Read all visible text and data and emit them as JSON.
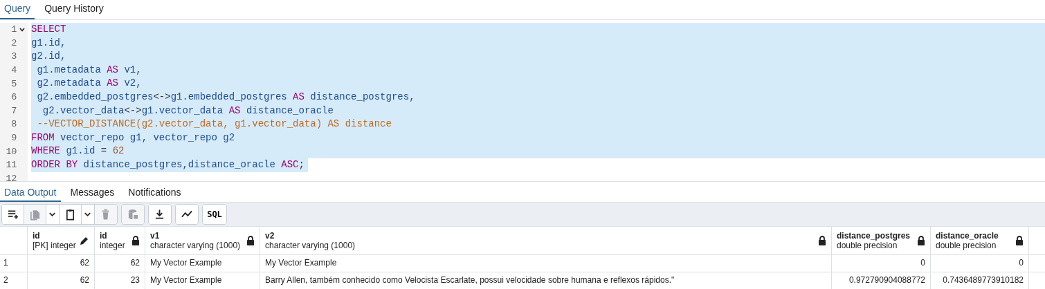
{
  "editor_tabs": [
    {
      "label": "Query",
      "selected": true
    },
    {
      "label": "Query History",
      "selected": false
    }
  ],
  "editor": {
    "lines": [
      {
        "number": "1",
        "foldable": true,
        "selected": true,
        "tokens": [
          {
            "kind": "kw",
            "text": "SELECT"
          }
        ]
      },
      {
        "number": "2",
        "foldable": false,
        "selected": true,
        "tokens": [
          {
            "kind": "id",
            "text": "g1.id,"
          }
        ]
      },
      {
        "number": "3",
        "foldable": false,
        "selected": true,
        "tokens": [
          {
            "kind": "id",
            "text": "g2.id,"
          }
        ]
      },
      {
        "number": "4",
        "foldable": false,
        "selected": true,
        "tokens": [
          {
            "kind": "id",
            "text": " g1.metadata "
          },
          {
            "kind": "kw",
            "text": "AS"
          },
          {
            "kind": "id",
            "text": " v1,"
          }
        ]
      },
      {
        "number": "5",
        "foldable": false,
        "selected": true,
        "tokens": [
          {
            "kind": "id",
            "text": " g2.metadata "
          },
          {
            "kind": "kw",
            "text": "AS"
          },
          {
            "kind": "id",
            "text": " v2,"
          }
        ]
      },
      {
        "number": "6",
        "foldable": false,
        "selected": true,
        "tokens": [
          {
            "kind": "id",
            "text": " g2.embedded_postgres"
          },
          {
            "kind": "op",
            "text": "<->"
          },
          {
            "kind": "id",
            "text": "g1.embedded_postgres "
          },
          {
            "kind": "kw",
            "text": "AS"
          },
          {
            "kind": "id",
            "text": " distance_postgres,"
          }
        ]
      },
      {
        "number": "7",
        "foldable": false,
        "selected": true,
        "tokens": [
          {
            "kind": "id",
            "text": "  g2.vector_data"
          },
          {
            "kind": "op",
            "text": "<->"
          },
          {
            "kind": "id",
            "text": "g1.vector_data "
          },
          {
            "kind": "kw",
            "text": "AS"
          },
          {
            "kind": "id",
            "text": " distance_oracle"
          }
        ]
      },
      {
        "number": "8",
        "foldable": false,
        "selected": true,
        "tokens": [
          {
            "kind": "comment",
            "text": " --VECTOR_DISTANCE(g2.vector_data, g1.vector_data) AS distance"
          }
        ]
      },
      {
        "number": "9",
        "foldable": false,
        "selected": true,
        "tokens": [
          {
            "kind": "kw",
            "text": "FROM"
          },
          {
            "kind": "id",
            "text": " vector_repo g1, vector_repo g2"
          }
        ]
      },
      {
        "number": "10",
        "foldable": false,
        "selected": true,
        "tokens": [
          {
            "kind": "kw",
            "text": "WHERE"
          },
          {
            "kind": "id",
            "text": " g1.id "
          },
          {
            "kind": "op",
            "text": "="
          },
          {
            "kind": "num",
            "text": " 62"
          }
        ]
      },
      {
        "number": "11",
        "foldable": false,
        "selected": true,
        "tokens": [
          {
            "kind": "kw",
            "text": "ORDER BY"
          },
          {
            "kind": "id",
            "text": " distance_postgres,distance_oracle "
          },
          {
            "kind": "kw",
            "text": "ASC"
          },
          {
            "kind": "op",
            "text": ";"
          }
        ]
      },
      {
        "number": "12",
        "foldable": false,
        "selected": false
      }
    ]
  },
  "output_tabs": [
    {
      "label": "Data Output",
      "selected": true
    },
    {
      "label": "Messages",
      "selected": false
    },
    {
      "label": "Notifications",
      "selected": false
    }
  ],
  "toolbar": [
    {
      "kind": "add-row",
      "disabled": false
    },
    {
      "kind": "copy",
      "disabled": true
    },
    {
      "kind": "caret",
      "disabled": false
    },
    {
      "kind": "paste",
      "disabled": false
    },
    {
      "kind": "caret",
      "disabled": false
    },
    {
      "kind": "delete",
      "disabled": true
    },
    {
      "kind": "save",
      "disabled": true
    },
    {
      "kind": "download",
      "disabled": false
    },
    {
      "kind": "graph",
      "disabled": false
    },
    {
      "kind": "sql",
      "label": "SQL",
      "disabled": false
    }
  ],
  "table": {
    "columns": [
      {
        "name": "id",
        "type": "[PK] integer",
        "editable": true,
        "kind": "number"
      },
      {
        "name": "id",
        "type": "integer",
        "editable": false,
        "kind": "number"
      },
      {
        "name": "v1",
        "type": "character varying (1000)",
        "editable": false,
        "kind": "text"
      },
      {
        "name": "v2",
        "type": "character varying (1000)",
        "editable": false,
        "kind": "text"
      },
      {
        "name": "distance_postgres",
        "type": "double precision",
        "editable": false,
        "kind": "number"
      },
      {
        "name": "distance_oracle",
        "type": "double precision",
        "editable": false,
        "kind": "number"
      }
    ],
    "rows": [
      {
        "number": "1",
        "cells": [
          "62",
          "62",
          "My Vector Example",
          "My Vector Example",
          "0",
          "0"
        ]
      },
      {
        "number": "2",
        "cells": [
          "62",
          "23",
          "My Vector Example",
          "Barry Allen, também conhecido como Velocista Escarlate, possui velocidade sobre humana e reflexos rápidos.\"",
          "0.972790904088772",
          "0.7436489773910182"
        ]
      }
    ]
  }
}
